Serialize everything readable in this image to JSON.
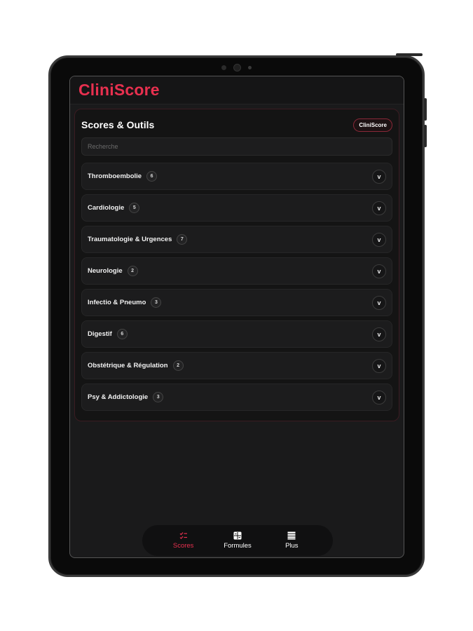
{
  "app": {
    "brand": "CliniScore",
    "accent_color": "#e8304f"
  },
  "panel": {
    "title": "Scores & Outils",
    "badge": "CliniScore",
    "search_placeholder": "Recherche",
    "search_value": ""
  },
  "categories": [
    {
      "label": "Thromboembolie",
      "count": "6",
      "icon": "chevron-down-icon"
    },
    {
      "label": "Cardiologie",
      "count": "5",
      "icon": "chevron-down-icon"
    },
    {
      "label": "Traumatologie & Urgences",
      "count": "7",
      "icon": "chevron-down-icon"
    },
    {
      "label": "Neurologie",
      "count": "2",
      "icon": "chevron-down-icon"
    },
    {
      "label": "Infectio & Pneumo",
      "count": "3",
      "icon": "chevron-down-icon"
    },
    {
      "label": "Digestif",
      "count": "6",
      "icon": "chevron-down-icon"
    },
    {
      "label": "Obstétrique & Régulation",
      "count": "2",
      "icon": "chevron-down-icon"
    },
    {
      "label": "Psy & Addictologie",
      "count": "3",
      "icon": "chevron-down-icon"
    }
  ],
  "chevron_glyph": "v",
  "tabs": [
    {
      "label": "Scores",
      "icon": "checklist-icon",
      "active": true
    },
    {
      "label": "Formules",
      "icon": "calculator-icon",
      "active": false
    },
    {
      "label": "Plus",
      "icon": "list-icon",
      "active": false
    }
  ]
}
